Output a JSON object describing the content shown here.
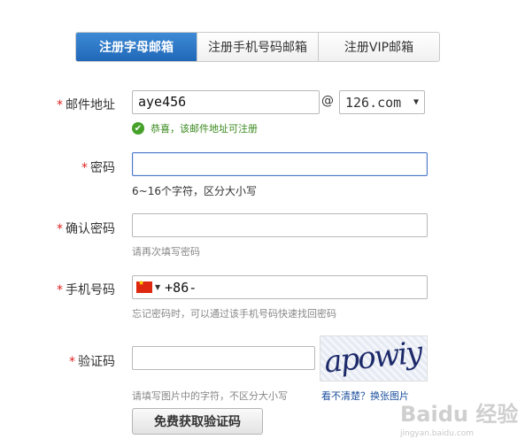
{
  "tabs": [
    {
      "label": "注册字母邮箱",
      "active": true
    },
    {
      "label": "注册手机号码邮箱",
      "active": false
    },
    {
      "label": "注册VIP邮箱",
      "active": false
    }
  ],
  "required_mark": "*",
  "email": {
    "label": "邮件地址",
    "value": "aye456",
    "at": "@",
    "domain": "126.com",
    "success": "恭喜，该邮件地址可注册"
  },
  "password": {
    "label": "密码",
    "value": "",
    "hint": "6~16个字符，区分大小写"
  },
  "confirm": {
    "label": "确认密码",
    "value": "",
    "hint": "请再次填写密码"
  },
  "phone": {
    "label": "手机号码",
    "prefix": "+86-",
    "hint": "忘记密码时，可以通过该手机号码快速找回密码"
  },
  "captcha": {
    "label": "验证码",
    "value": "",
    "image_text": "apowiy",
    "hint": "请填写图片中的字符，不区分大小写",
    "refresh": "看不清楚？换张图片",
    "free_button": "免费获取验证码"
  },
  "watermark": {
    "main": "Baidu 经验",
    "sub": "jingyan.baidu.com"
  },
  "colors": {
    "accent": "#2068b8",
    "required": "#dd2222",
    "success": "#45a12a",
    "link": "#1b4f9c"
  }
}
